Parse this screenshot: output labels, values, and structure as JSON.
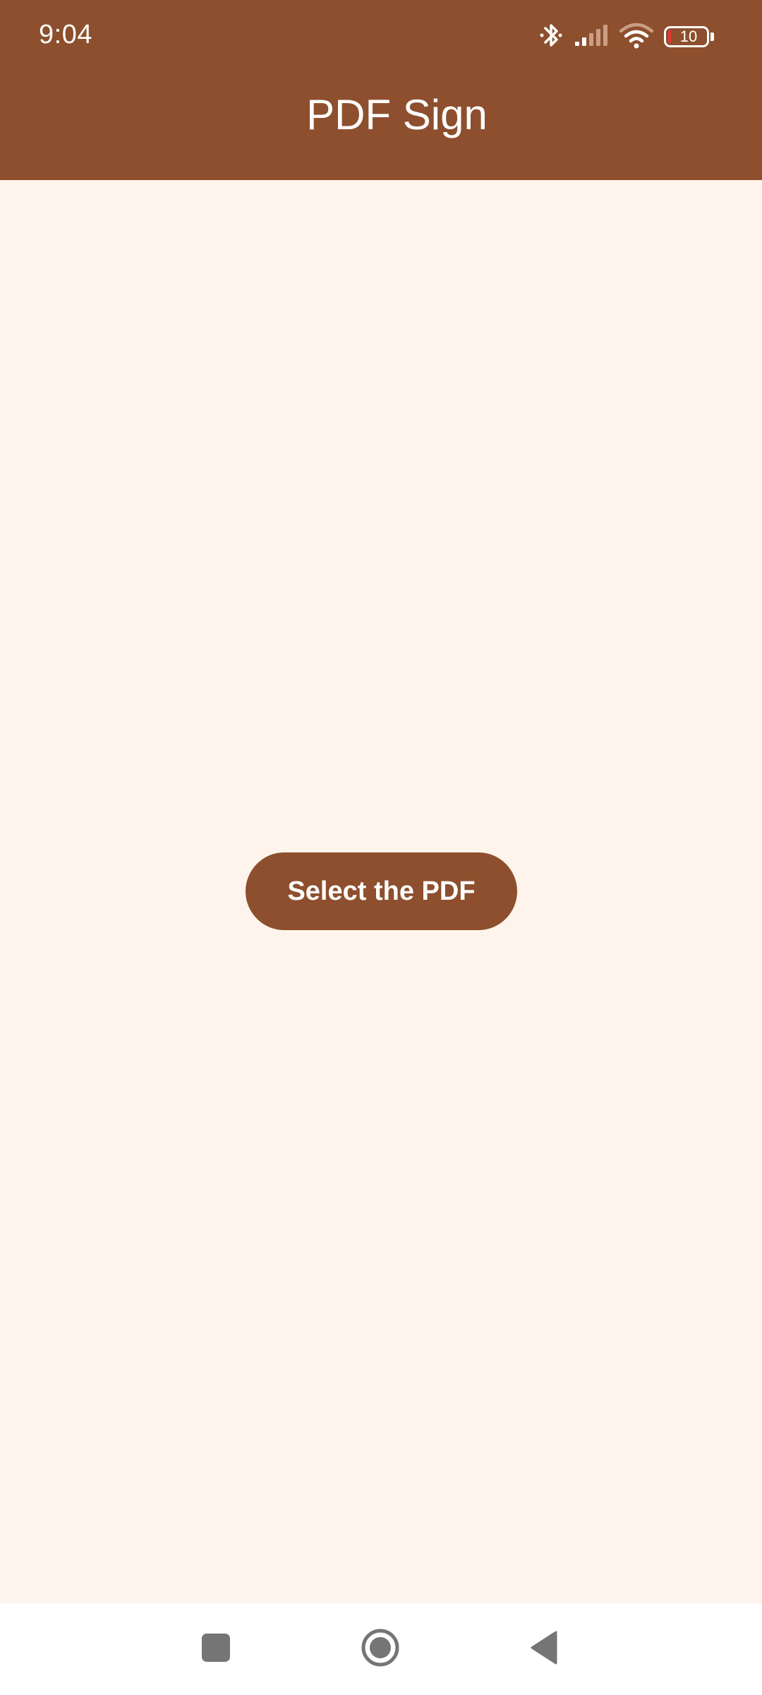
{
  "status_bar": {
    "time": "9:04",
    "battery_level": "10",
    "icons": [
      "bluetooth-icon",
      "signal-icon",
      "wifi-icon",
      "battery-icon"
    ]
  },
  "app_bar": {
    "title": "PDF Sign"
  },
  "main": {
    "select_button_label": "Select the PDF"
  },
  "nav_bar": {
    "icons": [
      "recents-icon",
      "home-icon",
      "back-icon"
    ]
  },
  "colors": {
    "primary": "#8D4F2D",
    "background": "#FFF4EC",
    "nav_background": "#FFFFFF",
    "battery_low": "#E53935"
  }
}
